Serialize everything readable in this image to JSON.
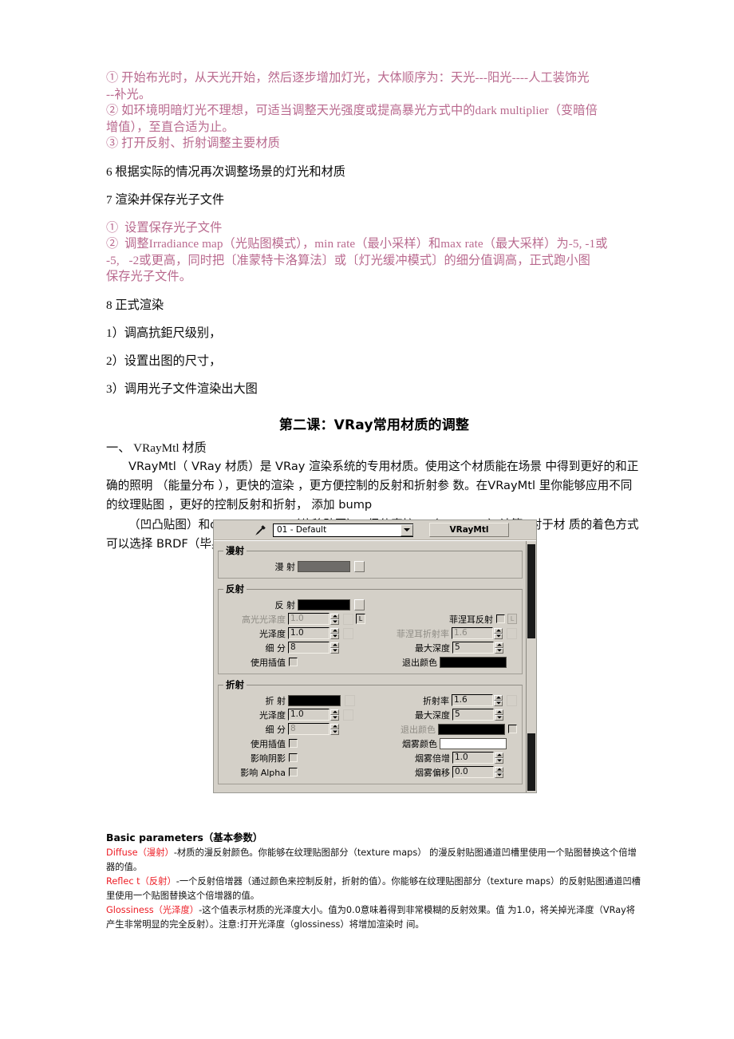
{
  "document": {
    "top_notes": [
      {
        "color": "#b9698e",
        "text": "① 开始布光时，从天光开始，然后逐步增加灯光，大体顺序为：天光---阳光----人工装饰光\n--补光。"
      },
      {
        "color": "#b9698e",
        "text": "② 如环境明暗灯光不理想，可适当调整天光强度或提高暴光方式中的dark multiplier（变暗倍\n增值），至直合适为止。"
      },
      {
        "color": "#b9698e",
        "text": "③ 打开反射、折射调整主要材质"
      }
    ],
    "steps": [
      {
        "text": "6  根据实际的情况再次调整场景的灯光和材质",
        "color": "#0a0a0a"
      },
      {
        "text": "7  渲染并保存光子文件",
        "color": "#0a0a0a"
      }
    ],
    "photon_notes": [
      {
        "color": "#b9698e",
        "text": "①  设置保存光子文件"
      },
      {
        "color": "#b9698e",
        "text": "②  调整Irradiance map（光贴图模式），min rate（最小采样）和max rate（最大采样）为-5, -1或\n-5,   -2或更高，同时把〔准蒙特卡洛算法〕或〔灯光缓冲模式〕的细分值调高，正式跑小图\n保存光子文件。"
      }
    ],
    "render_steps": [
      "8  正式渲染",
      "1）调高抗鉅尺级别，",
      "2）设置出图的尺寸，",
      "3）调用光子文件渲染出大图"
    ],
    "course_title": "第二课：VRay常用材质的调整",
    "section_heading": "一、  VRayMtl 材质",
    "intro_paragraph": "VRayMtl（ VRay 材质）是 VRay 渲染系统的专用材质。使用这个材质能在场景 中得到更好的和正确的照明 （能量分布 ），更快的渲染 ，更方便控制的反射和折射参 数。在VRayMtl 里你能够应用不同的纹理贴图 ，更好的控制反射和折射， 添加 bump",
    "intro_paragraph2": "（凹凸贴图）和displacement（位移贴图）， 促使直接GI（direct GI）计算, 对于材 质的着色方式可以选择 BRDF（毕奥定向反射分配函数）。详细参数如下："
  },
  "dialog": {
    "eyedropper_icon": "eyedropper-icon",
    "material_name": "01 - Default",
    "material_type": "VRayMtl",
    "dropdown_icon": "chevron-down-icon",
    "diffuse_group": {
      "legend": "漫射",
      "diffuse_label": "漫  射",
      "diffuse_color": "#6e6c69"
    },
    "reflect_group": {
      "legend": "反射",
      "reflect_label": "反  射",
      "reflect_color": "#000000",
      "hilight_gloss_label": "高光光泽度",
      "hilight_gloss_value": "1.0",
      "gloss_label": "光泽度",
      "gloss_value": "1.0",
      "subdivs_label": "细  分",
      "subdivs_value": "8",
      "interp_label": "使用插值",
      "fresnel_label": "菲涅耳反射",
      "fresnel_ior_label": "菲涅耳折射率",
      "fresnel_ior_value": "1.6",
      "maxdepth_label": "最大深度",
      "maxdepth_value": "5",
      "exit_color_label": "退出颜色",
      "exit_color": "#000000",
      "lock_glyph": "L"
    },
    "refract_group": {
      "legend": "折射",
      "refract_label": "折  射",
      "refract_color": "#000000",
      "gloss_label": "光泽度",
      "gloss_value": "1.0",
      "subdivs_label": "细  分",
      "subdivs_value": "8",
      "interp_label": "使用插值",
      "affect_shadow_label": "影响阴影",
      "affect_alpha_label": "影响 Alpha",
      "ior_label": "折射率",
      "ior_value": "1.6",
      "maxdepth_label": "最大深度",
      "maxdepth_value": "5",
      "exit_color_label": "退出颜色",
      "exit_color": "#000000",
      "fog_color_label": "烟雾颜色",
      "fog_color": "#ffffff",
      "fog_mult_label": "烟雾倍增",
      "fog_mult_value": "1.0",
      "fog_bias_label": "烟雾偏移",
      "fog_bias_value": "0.0"
    }
  },
  "notes": {
    "title": "Basic parameters（基本参数）",
    "items": [
      {
        "term": "Diffuse（漫射）",
        "body": "-材质的漫反射颜色。你能够在纹理贴图部分（texture maps） 的漫反射贴图通道凹槽里使用一个贴图替换这个倍增器的值。"
      },
      {
        "term": "Reflec t（反射）",
        "body": "-一个反射倍增器（通过颜色来控制反射，折射的值）。你能够在纹理贴图部分（texture maps）的反射贴图通道凹槽里使用一个贴图替换这个倍增器的值。"
      },
      {
        "term": "Glossiness（光泽度）",
        "body": "-这个值表示材质的光泽度大小。值为0.0意味着得到非常模糊的反射效果。值 为1.0，将关掉光泽度（VRay将产生非常明显的完全反射）。注意:打开光泽度（glossiness）将增加渲染时 间。"
      }
    ]
  }
}
